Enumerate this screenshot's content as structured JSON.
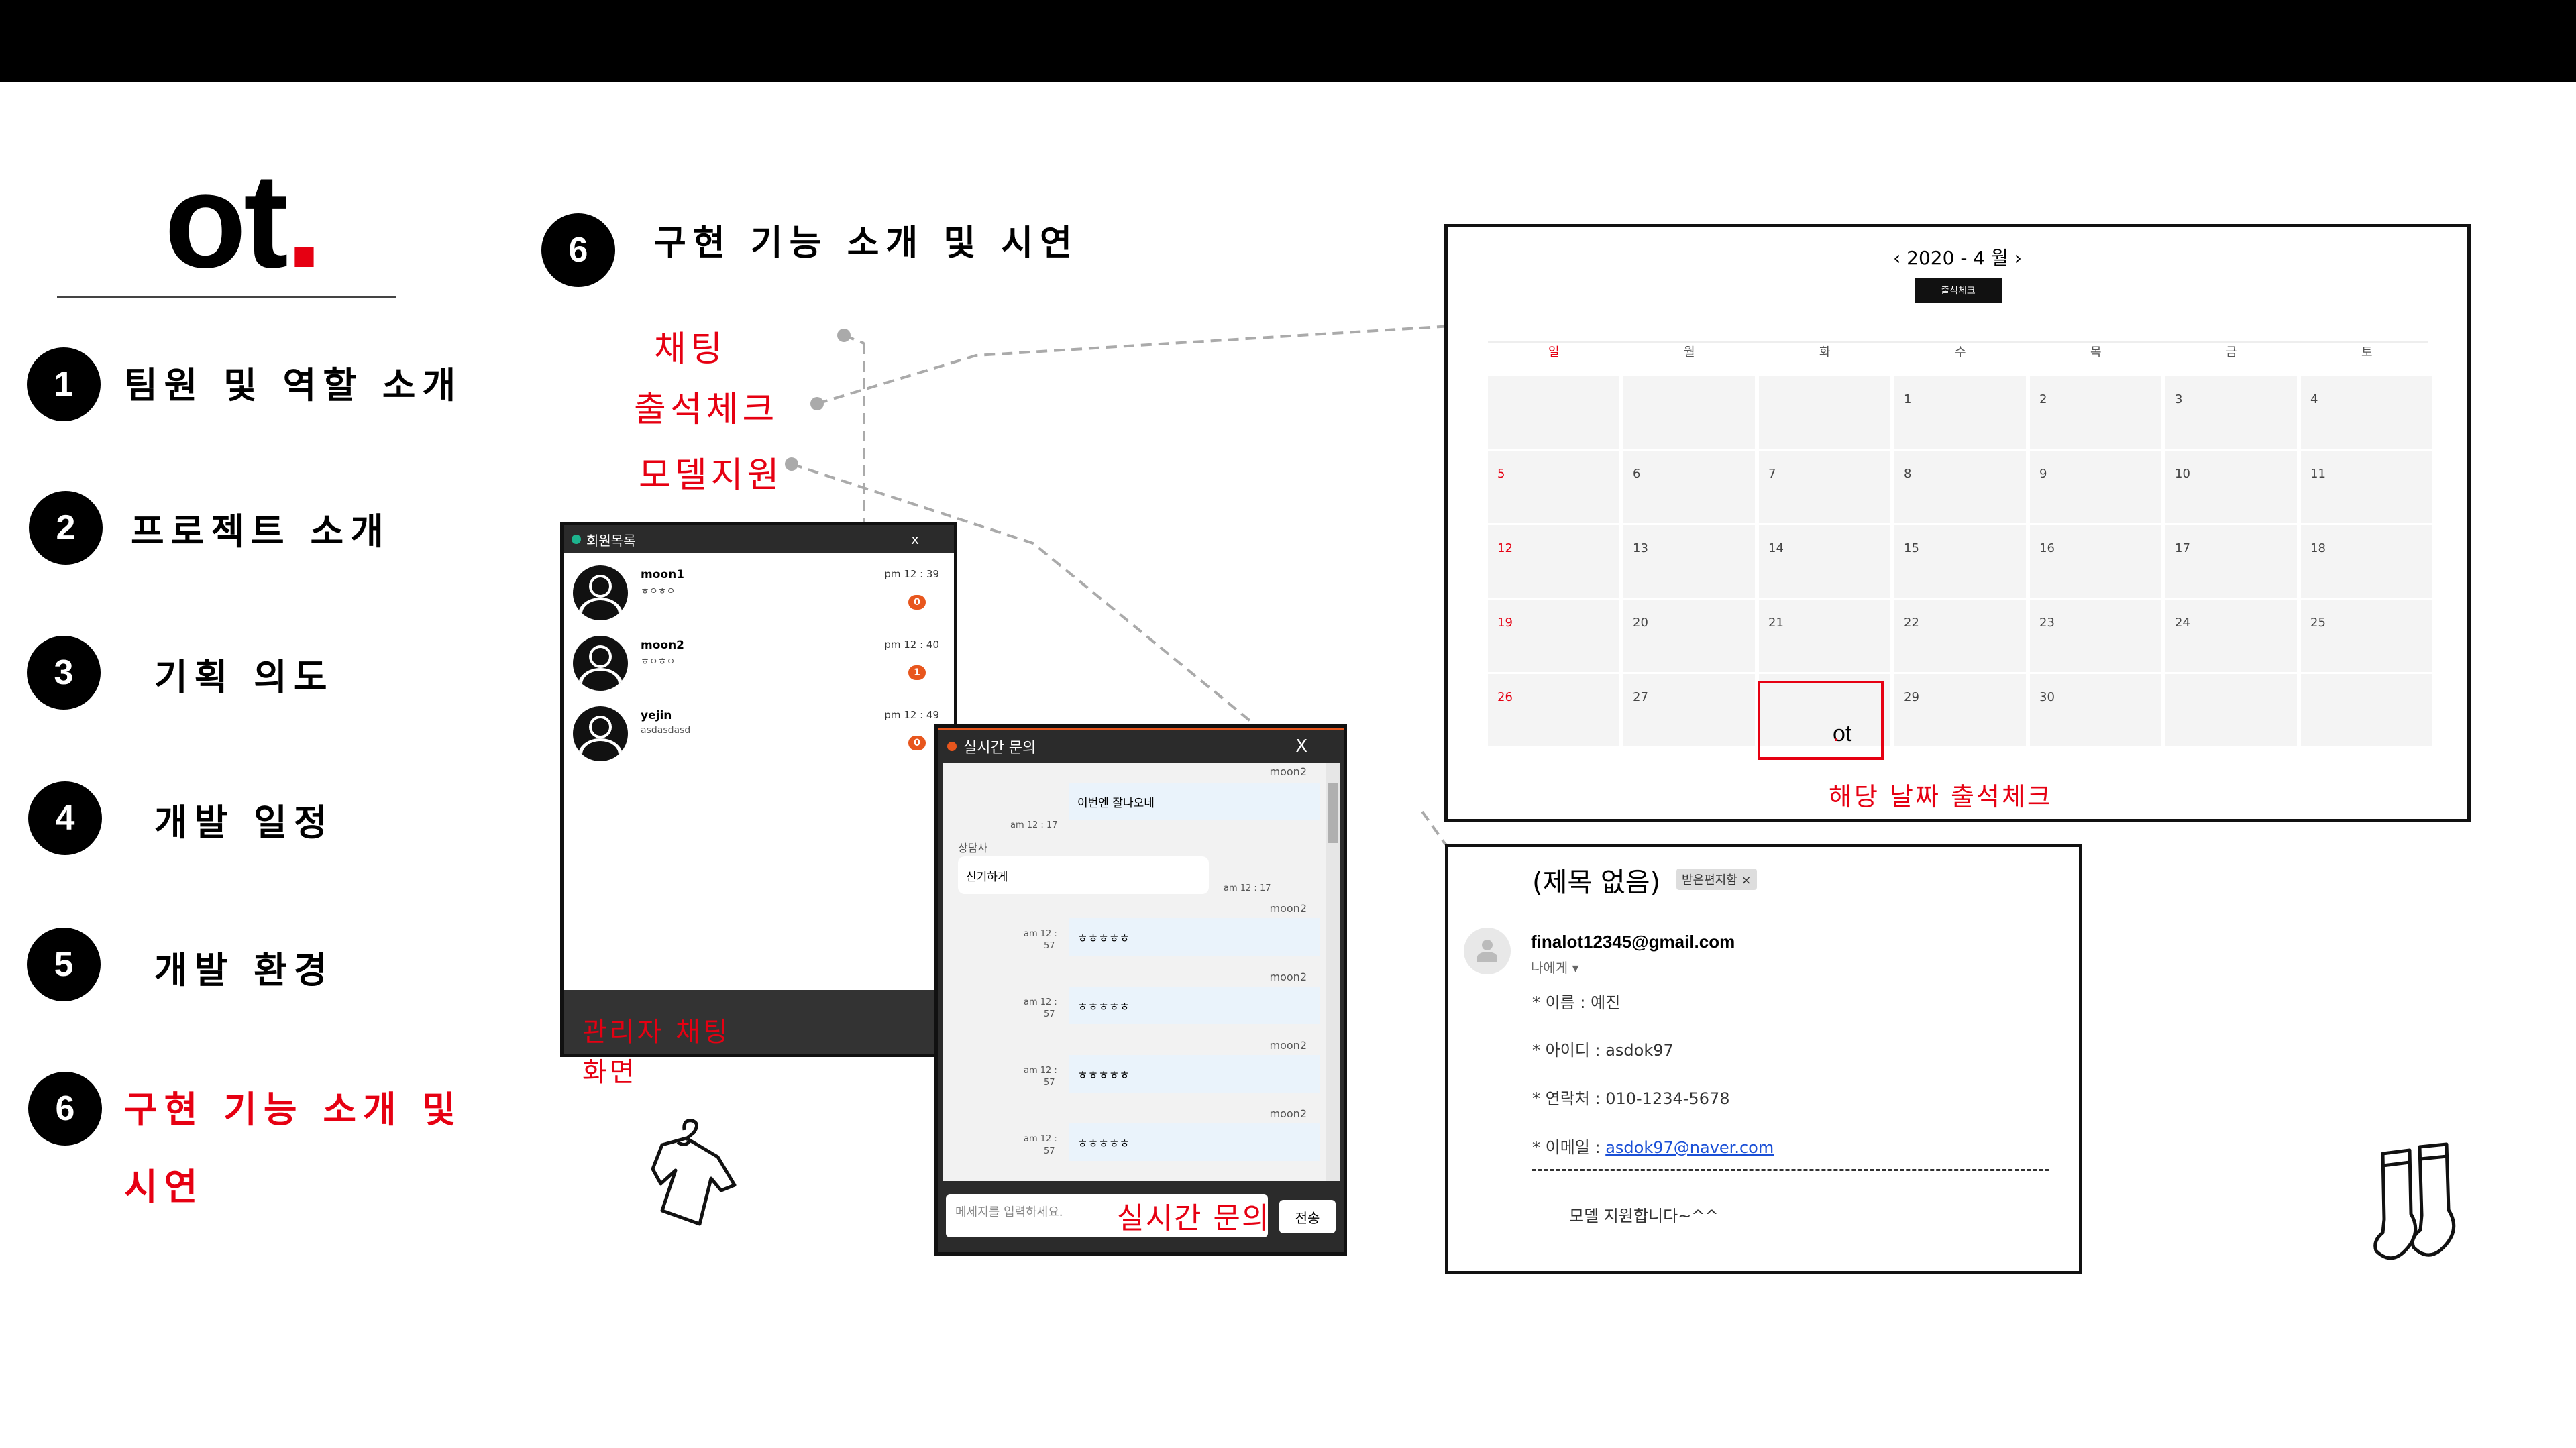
{
  "logo": {
    "text": "ot",
    "dot": "."
  },
  "menu": [
    {
      "num": "1",
      "label": "팀원 및 역할 소개"
    },
    {
      "num": "2",
      "label": "프로젝트 소개"
    },
    {
      "num": "3",
      "label": "기획 의도"
    },
    {
      "num": "4",
      "label": "개발 일정"
    },
    {
      "num": "5",
      "label": "개발 환경"
    },
    {
      "num": "6",
      "label": "구현 기능 소개 및",
      "label2": "시연"
    }
  ],
  "section": {
    "num": "6",
    "title": "구현 기능 소개 및 시연"
  },
  "notes": {
    "chat": "채팅",
    "attendance": "출석체크",
    "model": "모델지원",
    "admin_chat": "관리자 채팅",
    "admin_chat2": "화면",
    "live_inquiry": "실시간 문의",
    "attendance_check": "해당 날짜 출석체크"
  },
  "admin_chat": {
    "title": "회원목록",
    "close": "x",
    "members": [
      {
        "name": "moon1",
        "msg": "ㅎㅇㅎㅇ",
        "time": "pm 12 : 39",
        "unread": "0"
      },
      {
        "name": "moon2",
        "msg": "ㅎㅇㅎㅇ",
        "time": "pm 12 : 40",
        "unread": "1"
      },
      {
        "name": "yejin",
        "msg": "asdasdasd",
        "time": "pm 12 : 49",
        "unread": "0"
      }
    ]
  },
  "live_chat": {
    "title": "실시간 문의",
    "close": "X",
    "messages": [
      {
        "sender": "moon2",
        "text": "이번엔 잘나오네",
        "time": "am 12 : 17"
      },
      {
        "sender": "상담사",
        "text": "신기하게",
        "time": "am 12 : 17"
      },
      {
        "sender": "moon2",
        "text": "ㅎㅎㅎㅎㅎ",
        "time": "am 12 :",
        "time2": "57"
      },
      {
        "sender": "moon2",
        "text": "ㅎㅎㅎㅎㅎ",
        "time": "am 12 :",
        "time2": "57"
      },
      {
        "sender": "moon2",
        "text": "ㅎㅎㅎㅎㅎ",
        "time": "am 12 :",
        "time2": "57"
      },
      {
        "sender": "moon2",
        "text": "ㅎㅎㅎㅎㅎ",
        "time": "am 12 :",
        "time2": "57"
      }
    ],
    "placeholder": "메세지를 입력하세요.",
    "send": "전송"
  },
  "calendar": {
    "title": "‹ 2020 - 4 월 ›",
    "button": "출석체크",
    "weekdays": [
      "일",
      "월",
      "화",
      "수",
      "목",
      "금",
      "토"
    ],
    "weeks": [
      [
        "",
        "",
        "",
        "1",
        "2",
        "3",
        "4"
      ],
      [
        "5",
        "6",
        "7",
        "8",
        "9",
        "10",
        "11"
      ],
      [
        "12",
        "13",
        "14",
        "15",
        "16",
        "17",
        "18"
      ],
      [
        "19",
        "20",
        "21",
        "22",
        "23",
        "24",
        "25"
      ],
      [
        "26",
        "27",
        "",
        "29",
        "30",
        "",
        ""
      ]
    ],
    "stamp": {
      "text": "ot",
      "dot": "."
    }
  },
  "email": {
    "subject": "(제목 없음)",
    "tag": "받은편지함 ×",
    "from": "finalot12345@gmail.com",
    "to": "나에게 ▾",
    "lines": [
      "* 이름    : 예진",
      "* 아이디 : asdok97",
      "* 연락처 : 010-1234-5678"
    ],
    "email_label": "* 이메일 : ",
    "email_value": "asdok97@naver.com",
    "body": "모델 지원합니다~^^"
  },
  "icons": {
    "shirt": "t-shirt-icon",
    "socks": "socks-icon",
    "accent": "#e60012"
  }
}
